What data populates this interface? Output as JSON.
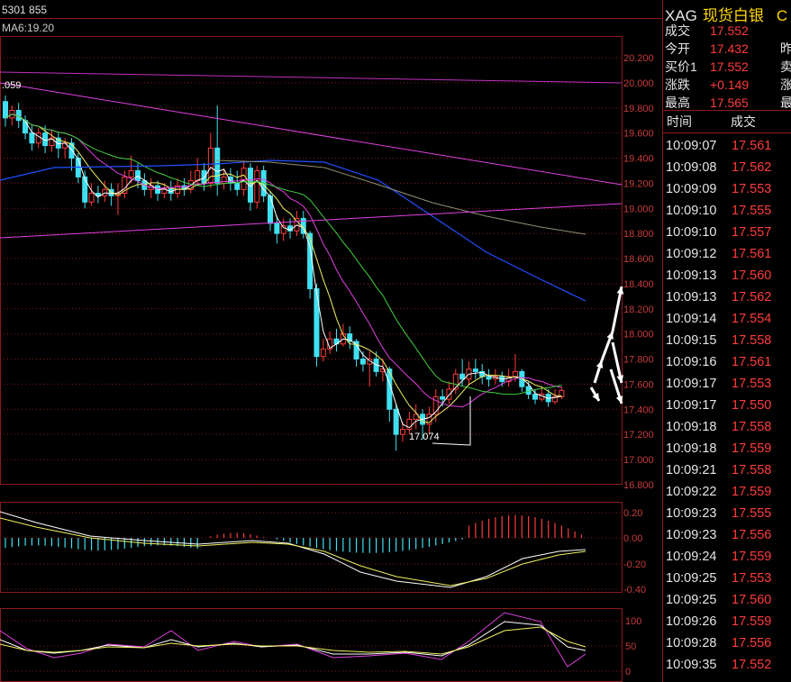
{
  "chart": {
    "top_left_text": "5301 855",
    "ma_label": "MA6:19.20",
    "high_marker": ".059",
    "low_marker": "17.074",
    "price_axis": [
      "20.200",
      "20.000",
      "19.800",
      "19.600",
      "19.400",
      "19.200",
      "19.000",
      "18.800",
      "18.600",
      "18.400",
      "18.200",
      "18.000",
      "17.800",
      "17.600",
      "17.400",
      "17.200",
      "17.000",
      "16.800"
    ],
    "macd_axis": [
      "0.20",
      "0.00",
      "-0.20",
      "-0.40"
    ],
    "kdj_axis": [
      "100",
      "50",
      "0"
    ],
    "colors": {
      "up": "#ff3b3b",
      "down": "#40e0f0",
      "grid": "#8b1a1a",
      "axis_text": "#c83c3c",
      "ma_white": "#ffffff",
      "ma_yellow": "#f0f060",
      "ma_magenta": "#e040e0",
      "ma_green": "#40d040",
      "ma_blue": "#2050ff",
      "ma_olive": "#909070"
    }
  },
  "quote": {
    "code": "XAG",
    "name": "现货白银",
    "more": "C",
    "rows": [
      {
        "label": "成交",
        "value": "17.552",
        "extra": ""
      },
      {
        "label": "今开",
        "value": "17.432",
        "extra": "昨"
      },
      {
        "label": "买价1",
        "value": "17.552",
        "extra": "卖"
      },
      {
        "label": "涨跌",
        "value": "+0.149",
        "extra": "涨"
      },
      {
        "label": "最高",
        "value": "17.565",
        "extra": "最"
      }
    ]
  },
  "ticks": {
    "header_time": "时间",
    "header_price": "成交",
    "rows": [
      {
        "time": "10:09:07",
        "price": "17.561"
      },
      {
        "time": "10:09:08",
        "price": "17.562"
      },
      {
        "time": "10:09:09",
        "price": "17.553"
      },
      {
        "time": "10:09:10",
        "price": "17.555"
      },
      {
        "time": "10:09:10",
        "price": "17.557"
      },
      {
        "time": "10:09:12",
        "price": "17.561"
      },
      {
        "time": "10:09:13",
        "price": "17.560"
      },
      {
        "time": "10:09:13",
        "price": "17.562"
      },
      {
        "time": "10:09:14",
        "price": "17.554"
      },
      {
        "time": "10:09:15",
        "price": "17.558"
      },
      {
        "time": "10:09:16",
        "price": "17.561"
      },
      {
        "time": "10:09:17",
        "price": "17.553"
      },
      {
        "time": "10:09:17",
        "price": "17.550"
      },
      {
        "time": "10:09:18",
        "price": "17.558"
      },
      {
        "time": "10:09:18",
        "price": "17.559"
      },
      {
        "time": "10:09:21",
        "price": "17.558"
      },
      {
        "time": "10:09:22",
        "price": "17.559"
      },
      {
        "time": "10:09:23",
        "price": "17.555"
      },
      {
        "time": "10:09:23",
        "price": "17.556"
      },
      {
        "time": "10:09:24",
        "price": "17.559"
      },
      {
        "time": "10:09:25",
        "price": "17.553"
      },
      {
        "time": "10:09:25",
        "price": "17.560"
      },
      {
        "time": "10:09:26",
        "price": "17.559"
      },
      {
        "time": "10:09:28",
        "price": "17.556"
      },
      {
        "time": "10:09:35",
        "price": "17.552"
      }
    ]
  }
}
